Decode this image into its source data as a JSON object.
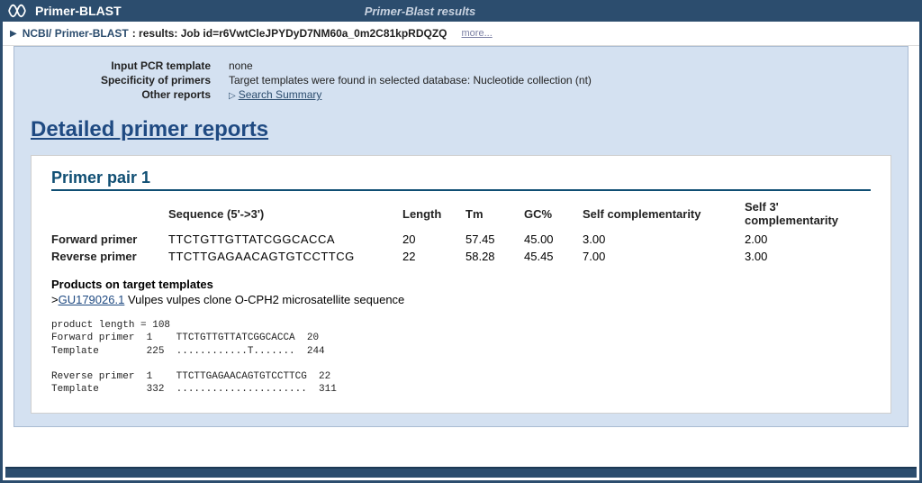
{
  "header": {
    "app_title": "Primer-BLAST",
    "results_label": "Primer-Blast results"
  },
  "breadcrumb": {
    "ncbi_label": "NCBI/ Primer-BLAST",
    "results_prefix": " : results: Job id=r6VwtCleJPYDyD7NM60a_0m2C81kpRDQZQ",
    "more_label": "more..."
  },
  "summary": {
    "labels": {
      "input_template": "Input PCR template",
      "specificity": "Specificity of primers",
      "other_reports": "Other reports"
    },
    "values": {
      "input_template": "none",
      "specificity": "Target templates were found in selected database: Nucleotide collection (nt)",
      "search_summary_label": "Search Summary"
    }
  },
  "reports": {
    "heading": "Detailed primer reports",
    "pair": {
      "title": "Primer pair 1",
      "headers": {
        "sequence": "Sequence (5'->3')",
        "length": "Length",
        "tm": "Tm",
        "gc": "GC%",
        "self_comp": "Self complementarity",
        "self3_comp": "Self 3' complementarity"
      },
      "rows": [
        {
          "label": "Forward primer",
          "sequence": "TTCTGTTGTTATCGGCACCA",
          "length": "20",
          "tm": "57.45",
          "gc": "45.00",
          "self_comp": "3.00",
          "self3_comp": "2.00"
        },
        {
          "label": "Reverse primer",
          "sequence": "TTCTTGAGAACAGTGTCCTTCG",
          "length": "22",
          "tm": "58.28",
          "gc": "45.45",
          "self_comp": "7.00",
          "self3_comp": "3.00"
        }
      ],
      "products_label": "Products on target templates",
      "target": {
        "accession": "GU179026.1",
        "description": " Vulpes vulpes clone O-CPH2 microsatellite sequence"
      },
      "alignment_text": "product length = 108\nForward primer  1    TTCTGTTGTTATCGGCACCA  20\nTemplate        225  ............T.......  244\n\nReverse primer  1    TTCTTGAGAACAGTGTCCTTCG  22\nTemplate        332  ......................  311"
    }
  }
}
